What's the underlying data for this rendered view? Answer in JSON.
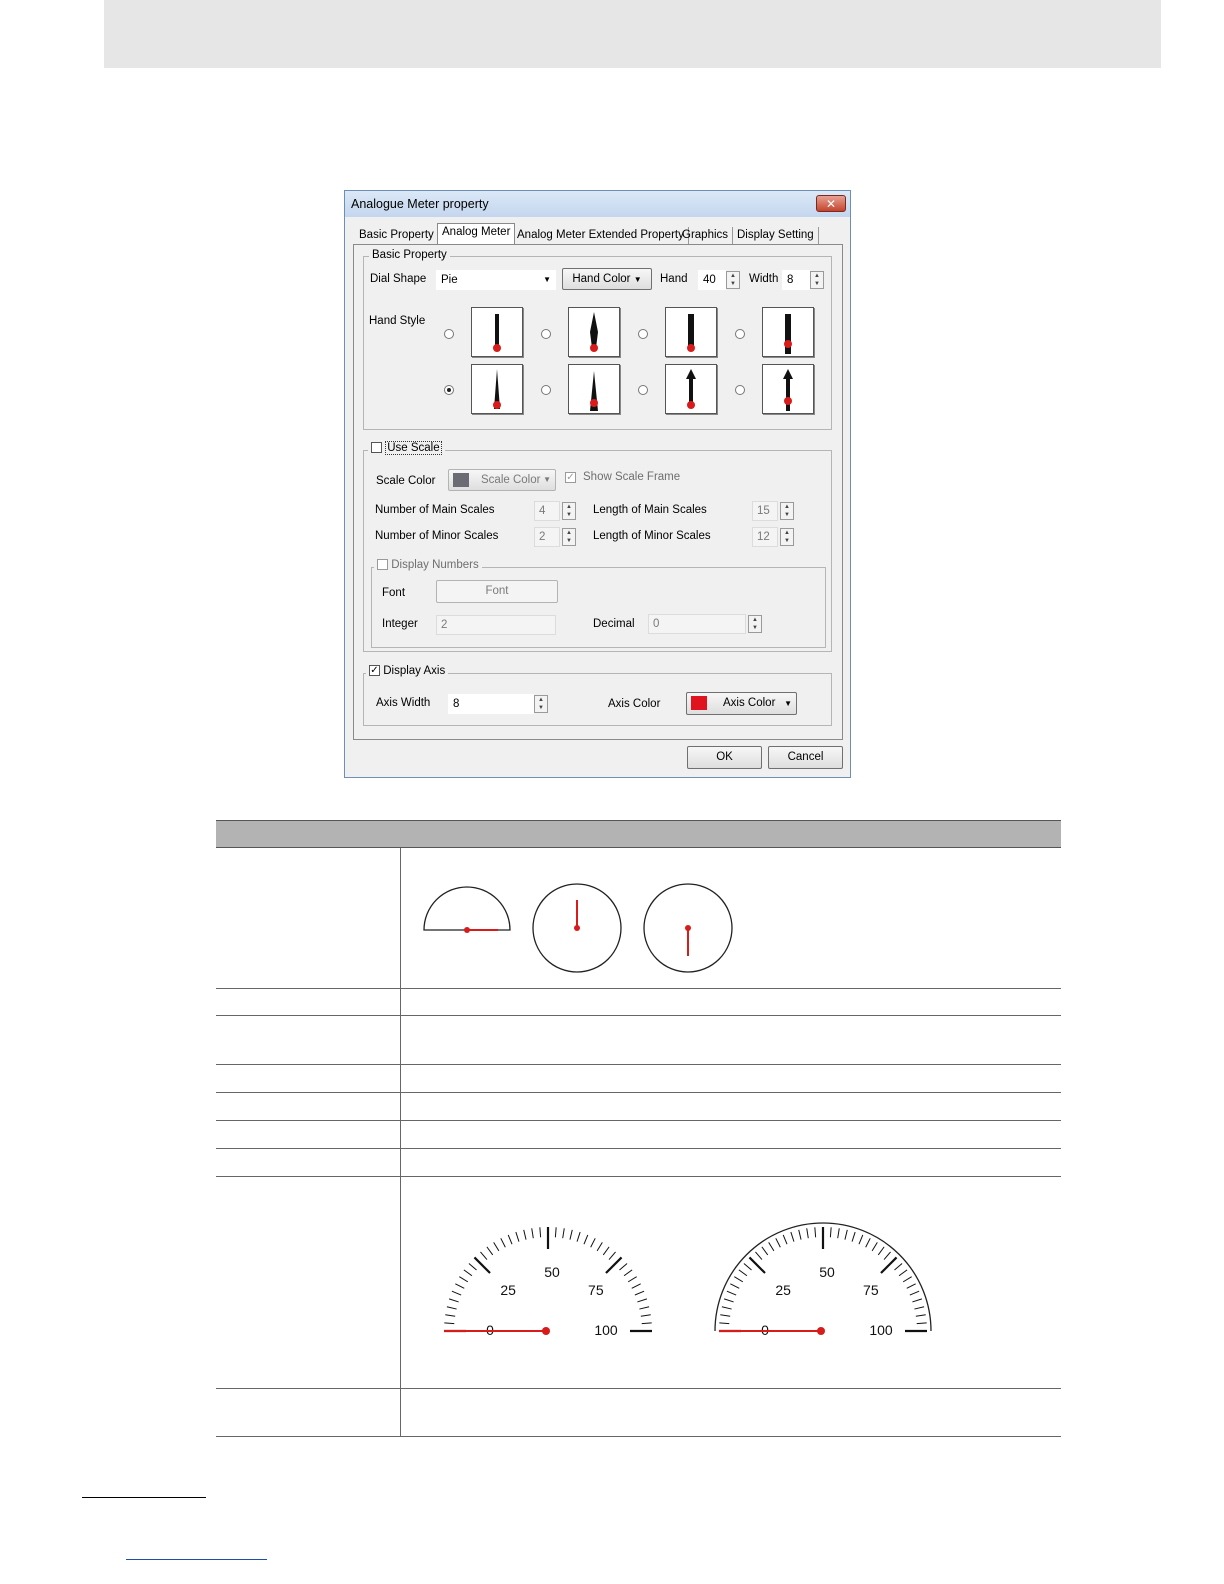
{
  "dialog": {
    "title": "Analogue Meter property",
    "close_label": "✕",
    "tabs": [
      "Basic Property",
      "Analog Meter",
      "Analog Meter Extended Property",
      "Graphics",
      "Display Setting"
    ],
    "active_tab": "Analog Meter",
    "basic_property": {
      "legend": "Basic Property",
      "dial_shape_label": "Dial Shape",
      "dial_shape_value": "Pie",
      "hand_color_label": "Hand Color",
      "hand_label": "Hand",
      "hand_value": "40",
      "width_label": "Width",
      "width_value": "8",
      "hand_style_label": "Hand Style",
      "selected_hand_style": 5
    },
    "use_scale": {
      "legend": "Use Scale",
      "checked": false,
      "scale_color_label": "Scale Color",
      "scale_color_button": "Scale Color",
      "scale_color": "#6b6b73",
      "show_scale_frame_label": "Show Scale Frame",
      "show_scale_frame_checked": true,
      "main_scales_label": "Number of Main Scales",
      "main_scales_value": "4",
      "minor_scales_label": "Number of Minor Scales",
      "minor_scales_value": "2",
      "length_main_label": "Length of Main Scales",
      "length_main_value": "15",
      "length_minor_label": "Length of Minor Scales",
      "length_minor_value": "12",
      "display_numbers": {
        "legend": "Display Numbers",
        "checked": false,
        "font_label": "Font",
        "font_button": "Font",
        "integer_label": "Integer",
        "integer_value": "2",
        "decimal_label": "Decimal",
        "decimal_value": "0"
      }
    },
    "display_axis": {
      "legend": "Display Axis",
      "checked": true,
      "axis_width_label": "Axis Width",
      "axis_width_value": "8",
      "axis_color_label": "Axis Color",
      "axis_color_button": "Axis Color",
      "axis_color": "#e0141e"
    },
    "ok_label": "OK",
    "cancel_label": "Cancel"
  },
  "colors": {
    "accent_red": "#d81b1b",
    "header_band": "#e6e6e6",
    "table_header": "#b3b3b3"
  },
  "meter_examples": {
    "scale_labels": [
      "0",
      "25",
      "50",
      "75",
      "100"
    ]
  }
}
